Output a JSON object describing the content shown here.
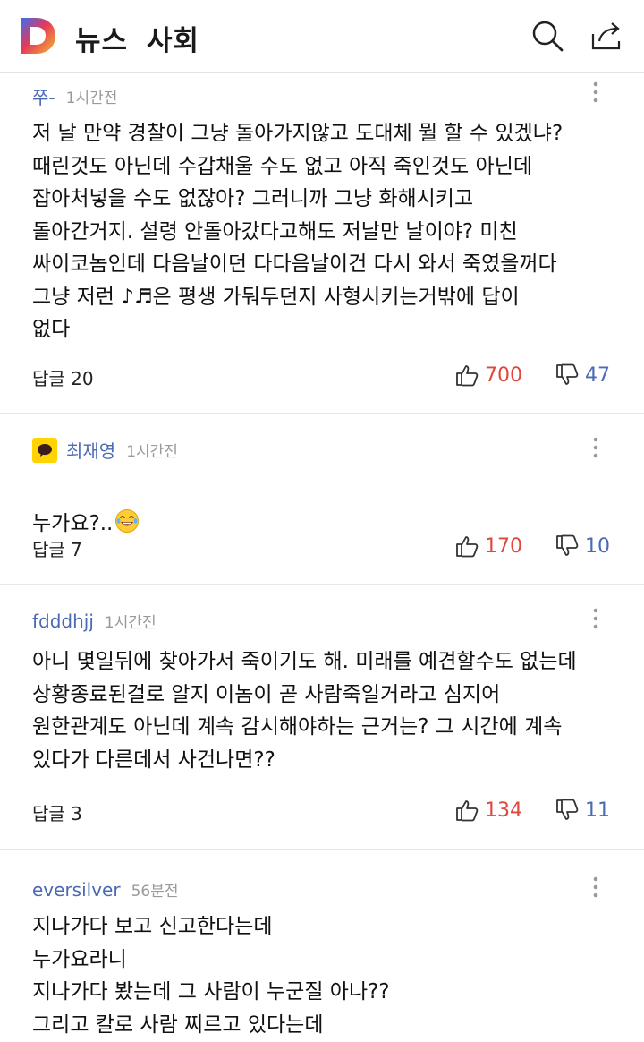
{
  "header": {
    "logo_letter": "D",
    "section_news": "뉴스",
    "section_name": "사회",
    "search_icon": "search-icon",
    "share_icon": "share-icon"
  },
  "comments": [
    {
      "author": "쭈-",
      "time": "1시간전",
      "text": "저 날 만약 경찰이 그냥 돌아가지않고 도대체 뭘 할 수 있겠냐?\n때린것도 아닌데 수갑채울 수도 없고 아직 죽인것도 아닌데\n잡아처넣을 수도 없잖아? 그러니까 그냥 화해시키고\n돌아간거지. 설령 안돌아갔다고해도 저날만 날이야? 미친\n싸이코놈인데 다음날이던 다다음날이건 다시 와서 죽였을꺼다\n그냥 저런 ♪♬은 평생 가둬두던지 사형시키는거밖에 답이\n없다",
      "reply": "답글 20",
      "likes": "700",
      "dislikes": "47"
    },
    {
      "author": "최재영",
      "time": "1시간전",
      "text": "누가요?..",
      "emoji": "laughing-tears-emoji",
      "reply": "답글 7",
      "likes": "170",
      "dislikes": "10"
    },
    {
      "author": "fdddhjj",
      "time": "1시간전",
      "text": "아니 몇일뒤에 찾아가서 죽이기도 해. 미래를 예견할수도 없는데\n상황종료된걸로 알지 이놈이 곧 사람죽일거라고 심지어\n원한관계도 아닌데 계속 감시해야하는 근거는? 그 시간에 계속\n있다가  다른데서 사건나면??",
      "reply": "답글 3",
      "likes": "134",
      "dislikes": "11"
    },
    {
      "author": "eversilver",
      "time": "56분전",
      "text": "지나가다 보고 신고한다는데\n누가요라니\n지나가다 봤는데 그 사람이 누군질 아나??\n그리고 칼로 사람 찌르고 있다는데"
    }
  ],
  "colors": {
    "author": "#4a6ab5",
    "like": "#e0473d",
    "dislike": "#4a6ab5",
    "kakao_badge": "#ffd400"
  }
}
